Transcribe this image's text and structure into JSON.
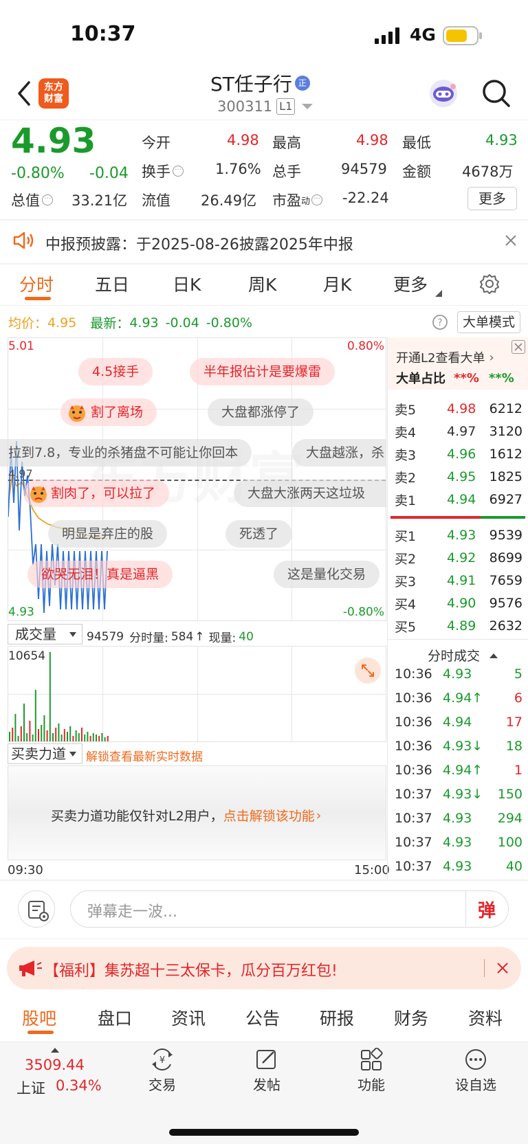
{
  "status_bar": {
    "time": "10:37",
    "network": "4G"
  },
  "header": {
    "back": "‹",
    "logo_line1": "东方",
    "logo_line2": "财富",
    "stock_name": "ST任子行",
    "stock_badge": "正",
    "stock_code": "300311",
    "level": "L1"
  },
  "quote": {
    "price": "4.93",
    "change_pct": "-0.80%",
    "change": "-0.04",
    "open_label": "今开",
    "open": "4.98",
    "high_label": "最高",
    "high": "4.98",
    "low_label": "最低",
    "low": "4.93",
    "turnover_label": "换手",
    "turnover": "1.76%",
    "volume_label": "总手",
    "volume": "94579",
    "amount_label": "金额",
    "amount": "4678万",
    "mktcap_label": "总值",
    "mktcap": "33.21亿",
    "float_label": "流值",
    "float": "26.49亿",
    "pe_label": "市盈",
    "pe_sup": "动",
    "pe": "-22.24",
    "more": "更多"
  },
  "notice": {
    "text": "中报预披露：于2025-08-26披露2025年中报"
  },
  "chart_tabs": [
    "分时",
    "五日",
    "日K",
    "周K",
    "月K",
    "更多"
  ],
  "info_bar": {
    "avg_label": "均价：",
    "avg": "4.95",
    "latest_label": "最新：",
    "latest": "4.93",
    "chg": "-0.04",
    "pct": "-0.80%",
    "mode_button": "大单模式"
  },
  "chart": {
    "top_price": "5.01",
    "top_pct": "0.80%",
    "bottom_price": "4.93",
    "bottom_pct": "-0.80%",
    "ref_price": "4.97"
  },
  "danmu": [
    "4.5接手",
    "半年报估计是要爆雷",
    "割了离场",
    "大盘都涨停了",
    "拉到7.8，专业的杀猪盘不可能让你回本",
    "大盘越涨，杀",
    "割肉了，可以拉了",
    "大盘大涨两天这垃圾",
    "明显是弃庄的股",
    "死透了",
    "欲哭无泪！真是逼黑",
    "这是量化交易"
  ],
  "volume_bar": {
    "label": "成交量",
    "total": "94579",
    "minute_label": "分时量:",
    "minute": "584",
    "now_label": "现量:",
    "now": "40",
    "max": "10654"
  },
  "force_bar": {
    "label": "买卖力道",
    "unlock_text": "解锁查看最新实时数据",
    "panel_text": "买卖力道功能仅针对L2用户，",
    "panel_link": "点击解锁该功能"
  },
  "time_axis": {
    "start": "09:30",
    "end": "15:00"
  },
  "orderbook": {
    "promo": "开通L2查看大单",
    "ratio_label": "大单占比",
    "ratio_buy": "**%",
    "ratio_sell": "**%",
    "asks": [
      {
        "label": "卖5",
        "price": "4.98",
        "vol": "6212"
      },
      {
        "label": "卖4",
        "price": "4.97",
        "vol": "3120"
      },
      {
        "label": "卖3",
        "price": "4.96",
        "vol": "1612"
      },
      {
        "label": "卖2",
        "price": "4.95",
        "vol": "1825"
      },
      {
        "label": "卖1",
        "price": "4.94",
        "vol": "6927"
      }
    ],
    "bids": [
      {
        "label": "买1",
        "price": "4.93",
        "vol": "9539"
      },
      {
        "label": "买2",
        "price": "4.92",
        "vol": "8699"
      },
      {
        "label": "买3",
        "price": "4.91",
        "vol": "7659"
      },
      {
        "label": "买4",
        "price": "4.90",
        "vol": "9576"
      },
      {
        "label": "买5",
        "price": "4.89",
        "vol": "2632"
      }
    ]
  },
  "ticks": {
    "title": "分时成交",
    "rows": [
      {
        "time": "10:36",
        "price": "4.93",
        "vol": "5"
      },
      {
        "time": "10:36",
        "price": "4.94↑",
        "vol": "6"
      },
      {
        "time": "10:36",
        "price": "4.94",
        "vol": "17"
      },
      {
        "time": "10:36",
        "price": "4.93↓",
        "vol": "18"
      },
      {
        "time": "10:36",
        "price": "4.94↑",
        "vol": "1"
      },
      {
        "time": "10:37",
        "price": "4.93↓",
        "vol": "150"
      },
      {
        "time": "10:37",
        "price": "4.93",
        "vol": "294"
      },
      {
        "time": "10:37",
        "price": "4.93",
        "vol": "100"
      },
      {
        "time": "10:37",
        "price": "4.93",
        "vol": "40"
      }
    ]
  },
  "danmu_input": {
    "placeholder": "弹幕走一波...",
    "send": "弹"
  },
  "promo_banner": {
    "text": "【福利】集苏超十三太保卡，瓜分百万红包!"
  },
  "bottom_tabs": [
    "股吧",
    "盘口",
    "资讯",
    "公告",
    "研报",
    "财务",
    "资料"
  ],
  "nav": {
    "index_value": "3509.44",
    "index_name": "上证",
    "index_pct": "0.34%",
    "trade": "交易",
    "post": "发帖",
    "func": "功能",
    "watch": "设自选"
  },
  "colors": {
    "up": "#e3262a",
    "down": "#1b9a2c",
    "accent": "#ef6a1d",
    "avg_line": "#f0a020",
    "price_line": "#2a6fd6"
  }
}
